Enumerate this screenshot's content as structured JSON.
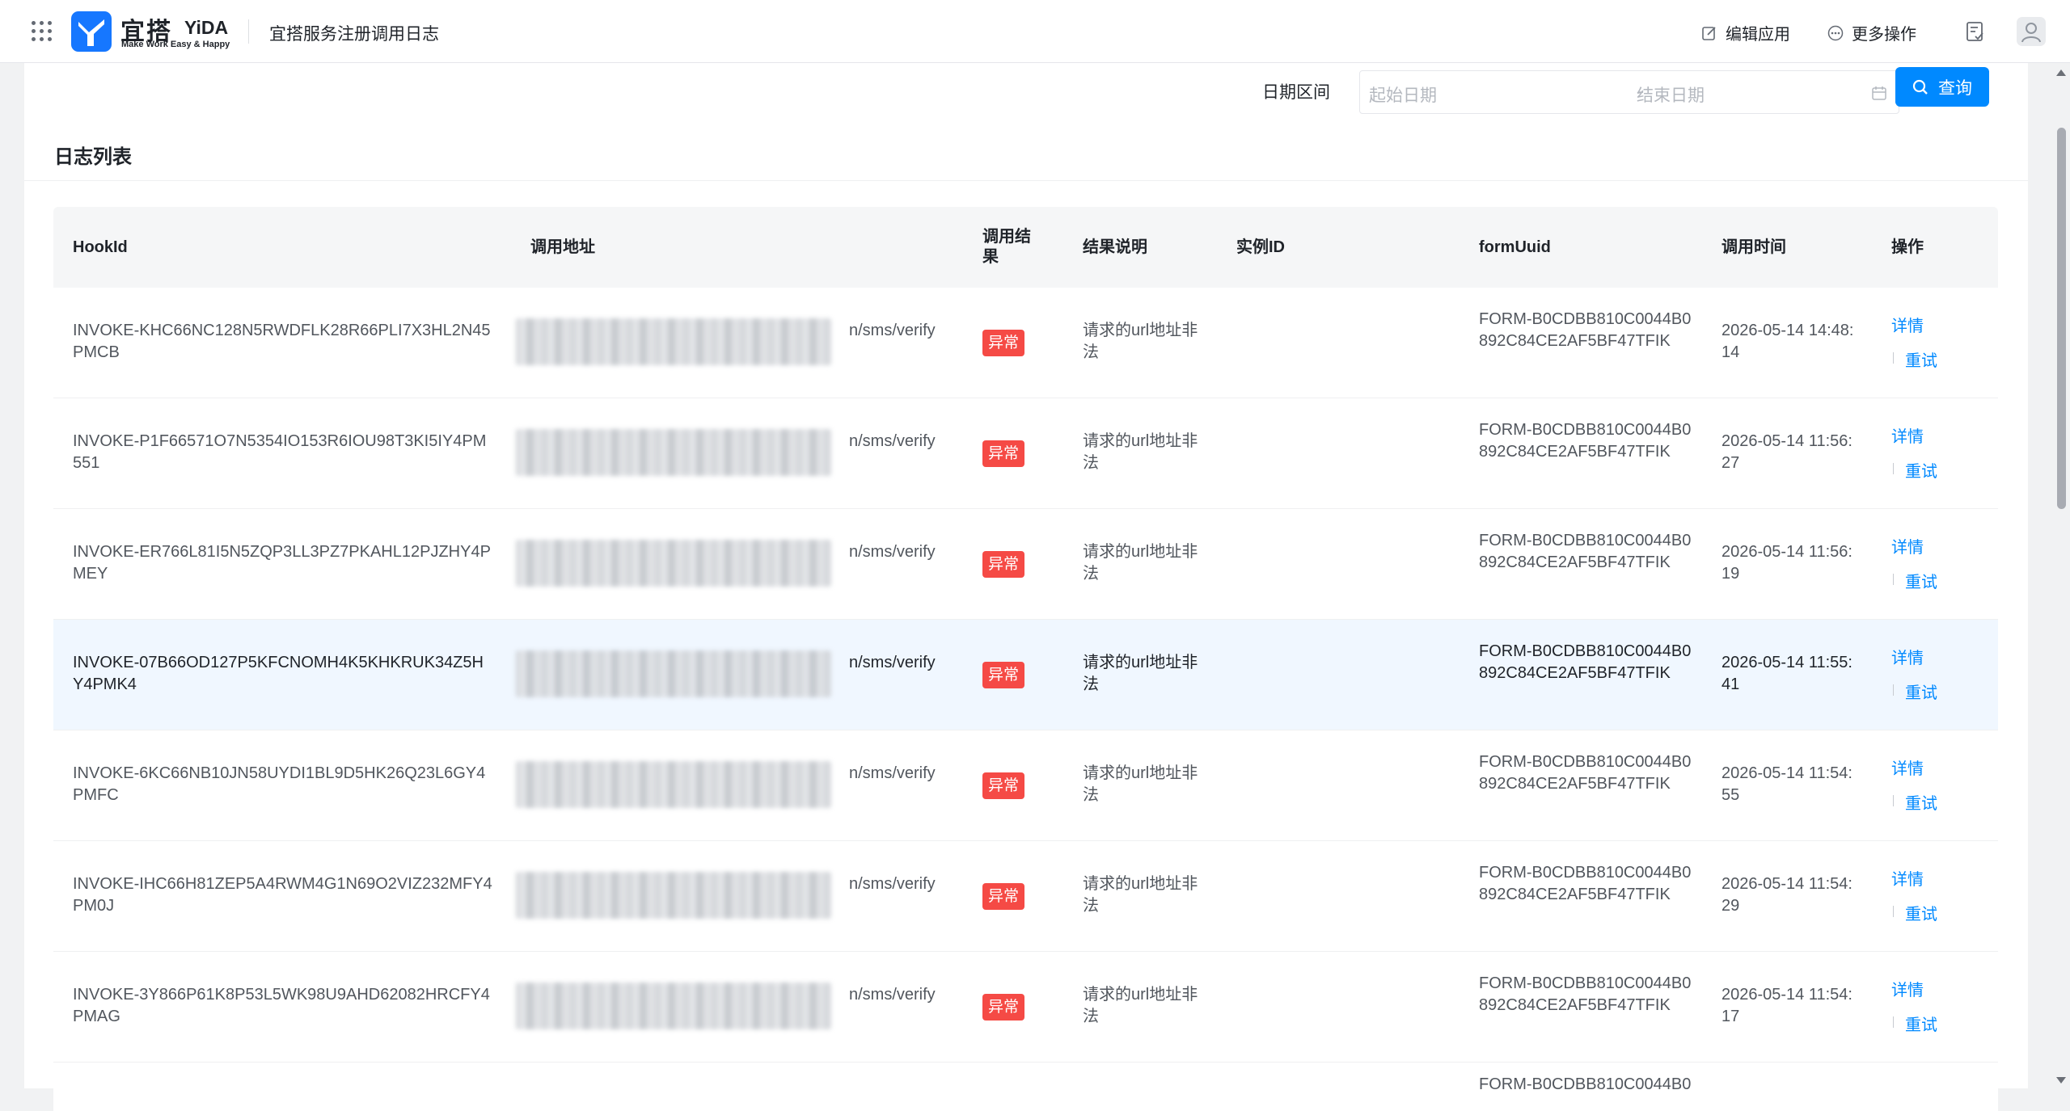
{
  "header": {
    "brand_cn": "宜搭",
    "brand_en": "YiDA",
    "brand_slogan": "Make Work Easy & Happy",
    "app_title": "宜搭服务注册调用日志",
    "edit_app": "编辑应用",
    "more_actions": "更多操作"
  },
  "filter": {
    "label": "日期区间",
    "start_placeholder": "起始日期",
    "separator": "-",
    "end_placeholder": "结束日期",
    "query": "查询"
  },
  "section": {
    "title": "日志列表"
  },
  "table": {
    "columns": [
      "HookId",
      "调用地址",
      "调用结果",
      "结果说明",
      "实例ID",
      "formUuid",
      "调用时间",
      "操作"
    ],
    "actions": {
      "detail": "详情",
      "retry": "重试"
    },
    "rows": [
      {
        "hookId": "INVOKE-KHC66NC128N5RWDFLK28R66PLI7X3HL2N45PMCB",
        "url": "n/sms/verify",
        "result": "异常",
        "desc": "请求的url地址非法",
        "instanceId": "",
        "formUuid": "FORM-B0CDBB810C0044B0892C84CE2AF5BF47TFIK",
        "time": "2026-05-14 14:48:14",
        "highlight": false
      },
      {
        "hookId": "INVOKE-P1F66571O7N5354IO153R6IOU98T3KI5IY4PM551",
        "url": "n/sms/verify",
        "result": "异常",
        "desc": "请求的url地址非法",
        "instanceId": "",
        "formUuid": "FORM-B0CDBB810C0044B0892C84CE2AF5BF47TFIK",
        "time": "2026-05-14 11:56:27",
        "highlight": false
      },
      {
        "hookId": "INVOKE-ER766L81I5N5ZQP3LL3PZ7PKAHL12PJZHY4PMEY",
        "url": "n/sms/verify",
        "result": "异常",
        "desc": "请求的url地址非法",
        "instanceId": "",
        "formUuid": "FORM-B0CDBB810C0044B0892C84CE2AF5BF47TFIK",
        "time": "2026-05-14 11:56:19",
        "highlight": false
      },
      {
        "hookId": "INVOKE-07B66OD127P5KFCNOMH4K5KHKRUK34Z5HY4PMK4",
        "url": "n/sms/verify",
        "result": "异常",
        "desc": "请求的url地址非法",
        "instanceId": "",
        "formUuid": "FORM-B0CDBB810C0044B0892C84CE2AF5BF47TFIK",
        "time": "2026-05-14 11:55:41",
        "highlight": true
      },
      {
        "hookId": "INVOKE-6KC66NB10JN58UYDI1BL9D5HK26Q23L6GY4PMFC",
        "url": "n/sms/verify",
        "result": "异常",
        "desc": "请求的url地址非法",
        "instanceId": "",
        "formUuid": "FORM-B0CDBB810C0044B0892C84CE2AF5BF47TFIK",
        "time": "2026-05-14 11:54:55",
        "highlight": false
      },
      {
        "hookId": "INVOKE-IHC66H81ZEP5A4RWM4G1N69O2VIZ232MFY4PM0J",
        "url": "n/sms/verify",
        "result": "异常",
        "desc": "请求的url地址非法",
        "instanceId": "",
        "formUuid": "FORM-B0CDBB810C0044B0892C84CE2AF5BF47TFIK",
        "time": "2026-05-14 11:54:29",
        "highlight": false
      },
      {
        "hookId": "INVOKE-3Y866P61K8P53L5WK98U9AHD62082HRCFY4PMAG",
        "url": "n/sms/verify",
        "result": "异常",
        "desc": "请求的url地址非法",
        "instanceId": "",
        "formUuid": "FORM-B0CDBB810C0044B0892C84CE2AF5BF47TFIK",
        "time": "2026-05-14 11:54:17",
        "highlight": false
      }
    ]
  },
  "colors": {
    "primary": "#0089ff",
    "danger": "#f54a45",
    "highlight_row": "#f0f7ff"
  },
  "icons": [
    "app-grid-icon",
    "yida-logo-icon",
    "edit-icon",
    "more-icon",
    "todo-icon",
    "user-icon",
    "calendar-icon",
    "search-icon"
  ]
}
